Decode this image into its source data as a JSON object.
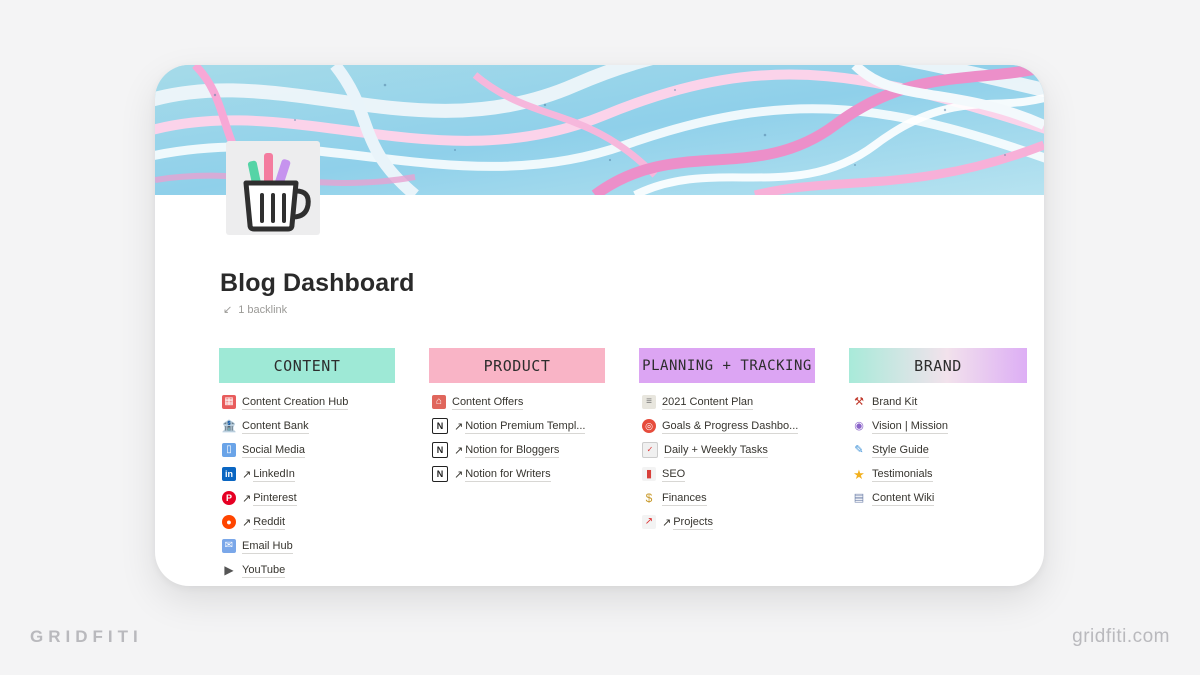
{
  "page": {
    "title": "Blog Dashboard",
    "backlinks": "1 backlink",
    "icon": "coffee-mug-pens-icon"
  },
  "columns": [
    {
      "header": "CONTENT",
      "color": "#9ee9d6",
      "items": [
        {
          "label": "Content Creation Hub",
          "icon": "calendar-icon",
          "external": false
        },
        {
          "label": "Content Bank",
          "icon": "bank-icon",
          "external": false
        },
        {
          "label": "Social Media",
          "icon": "phone-icon",
          "external": false
        },
        {
          "label": "LinkedIn",
          "icon": "linkedin-icon",
          "external": true
        },
        {
          "label": "Pinterest",
          "icon": "pinterest-icon",
          "external": true
        },
        {
          "label": "Reddit",
          "icon": "reddit-icon",
          "external": true
        },
        {
          "label": "Email Hub",
          "icon": "email-icon",
          "external": false
        },
        {
          "label": "YouTube",
          "icon": "video-camera-icon",
          "external": false
        }
      ]
    },
    {
      "header": "PRODUCT",
      "color": "#f9b4c6",
      "items": [
        {
          "label": "Content Offers",
          "icon": "store-icon",
          "external": false
        },
        {
          "label": "Notion Premium Templ...",
          "icon": "notion-icon",
          "external": true
        },
        {
          "label": "Notion for Bloggers",
          "icon": "notion-icon",
          "external": true
        },
        {
          "label": "Notion for Writers",
          "icon": "notion-icon",
          "external": true
        }
      ]
    },
    {
      "header": "PLANNING + TRACKING",
      "color": "#dca5f3",
      "items": [
        {
          "label": "2021 Content Plan",
          "icon": "notepad-icon",
          "external": false
        },
        {
          "label": "Goals & Progress Dashbo...",
          "icon": "target-icon",
          "external": false
        },
        {
          "label": "Daily + Weekly Tasks",
          "icon": "calendar-check-icon",
          "external": false
        },
        {
          "label": "SEO",
          "icon": "bar-chart-icon",
          "external": false
        },
        {
          "label": "Finances",
          "icon": "money-bag-icon",
          "external": false
        },
        {
          "label": "Projects",
          "icon": "chart-up-icon",
          "external": true
        }
      ]
    },
    {
      "header": "BRAND",
      "color": "#b4ecdc",
      "items": [
        {
          "label": "Brand Kit",
          "icon": "toolbox-icon",
          "external": false
        },
        {
          "label": "Vision | Mission",
          "icon": "crystal-ball-icon",
          "external": false
        },
        {
          "label": "Style Guide",
          "icon": "paintbrush-icon",
          "external": false
        },
        {
          "label": "Testimonials",
          "icon": "star-icon",
          "external": false
        },
        {
          "label": "Content Wiki",
          "icon": "books-icon",
          "external": false
        }
      ]
    }
  ],
  "watermark": {
    "left": "GRIDFITI",
    "right": "gridfiti.com"
  }
}
